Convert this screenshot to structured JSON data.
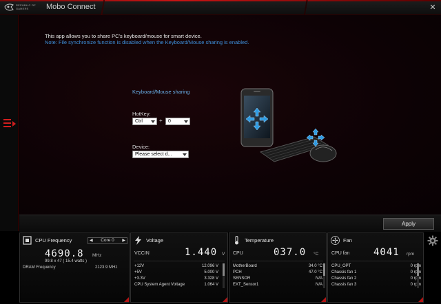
{
  "window": {
    "brand": "REPUBLIC OF GAMERS",
    "title": "Mobo Connect"
  },
  "main": {
    "intro": "This app allows you to share PC's keyboard/mouse for smart device.",
    "note": "Note: File synchronize function is disabled when the Keyboard/Mouse sharing is enabled.",
    "section_title": "Keyboard/Mouse sharing",
    "hotkey_label": "HotKey:",
    "hotkey_modifier": "Ctrl",
    "plus": "+",
    "hotkey_key": "0",
    "device_label": "Device:",
    "device_value": "Please select d..."
  },
  "apply_label": "Apply",
  "cpu": {
    "title": "CPU Frequency",
    "core": "Core 0",
    "freq": "4690.8",
    "freq_unit": "MHz",
    "detail": "99.8  x 47  ( 15.4    watts )",
    "dram_label": "DRAM Frequency",
    "dram_value": "2123.9 MHz"
  },
  "voltage": {
    "title": "Voltage",
    "main_label": "VCCIN",
    "main_value": "1.440",
    "main_unit": "V",
    "rows": [
      {
        "label": "+12V",
        "value": "12.096 V"
      },
      {
        "label": "+5V",
        "value": "5.000 V"
      },
      {
        "label": "+3.3V",
        "value": "3.328 V"
      },
      {
        "label": "CPU System Agent Voltage",
        "value": "1.064 V"
      }
    ]
  },
  "temperature": {
    "title": "Temperature",
    "main_label": "CPU",
    "main_value": "037.0",
    "main_unit": "°C",
    "rows": [
      {
        "label": "MotherBoard",
        "value": "34.0 °C"
      },
      {
        "label": "PCH",
        "value": "47.0 °C"
      },
      {
        "label": "SENSOR",
        "value": "N/A"
      },
      {
        "label": "EXT_Sensor1",
        "value": "N/A"
      }
    ]
  },
  "fan": {
    "title": "Fan",
    "main_label": "CPU fan",
    "main_value": "4041",
    "main_unit": "rpm",
    "rows": [
      {
        "label": "CPU_OPT",
        "value": "0  rpm"
      },
      {
        "label": "Chassis fan 1",
        "value": "0  rpm"
      },
      {
        "label": "Chassis fan 2",
        "value": "0  rpm"
      },
      {
        "label": "Chassis fan 3",
        "value": "0  rpm"
      }
    ]
  },
  "colors": {
    "accent_red": "#d21e1e",
    "link_blue": "#3e8ed8",
    "heading_blue": "#6ab0ea"
  },
  "icons": [
    "rog-logo-icon",
    "close-icon",
    "menu-toggle-icon",
    "cpu-icon",
    "voltage-icon",
    "temperature-icon",
    "fan-icon",
    "gear-icon"
  ]
}
